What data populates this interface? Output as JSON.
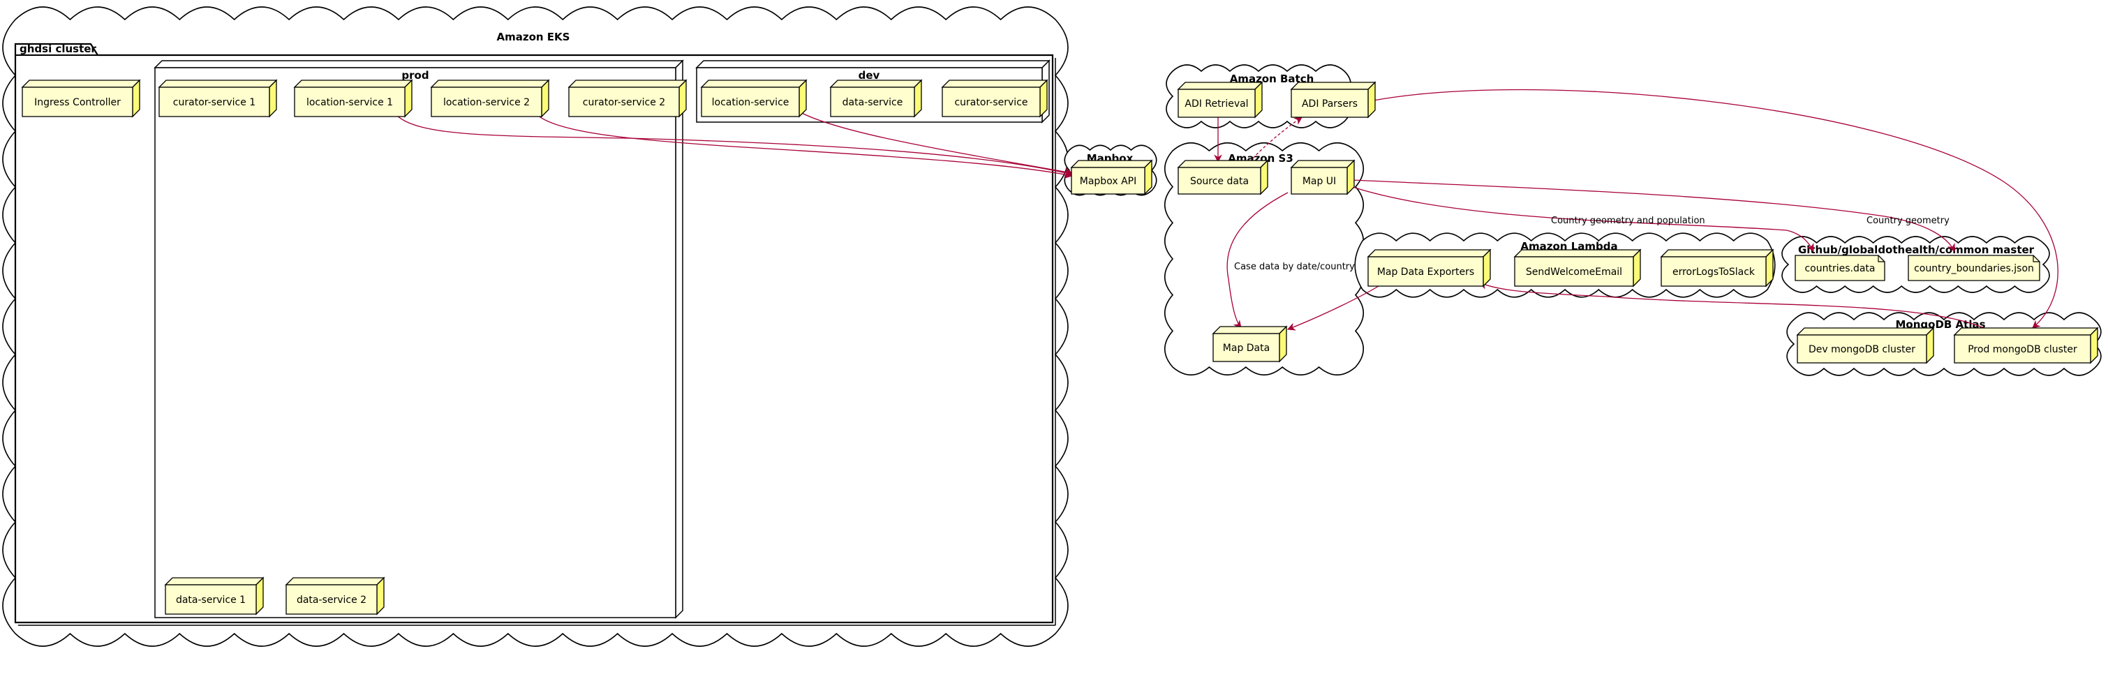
{
  "groups": {
    "eks": "Amazon EKS",
    "cluster": "ghdsi cluster",
    "prod": "prod",
    "dev": "dev",
    "mapbox": "Mapbox",
    "batch": "Amazon Batch",
    "s3": "Amazon S3",
    "lambda": "Amazon Lambda",
    "github": "Github/globaldothealth/common master",
    "mongo": "MongoDB Atlas"
  },
  "nodes": {
    "ingress": "Ingress Controller",
    "prod_curator1": "curator-service 1",
    "prod_location1": "location-service 1",
    "prod_location2": "location-service 2",
    "prod_curator2": "curator-service 2",
    "prod_data1": "data-service 1",
    "prod_data2": "data-service 2",
    "dev_location": "location-service",
    "dev_data": "data-service",
    "dev_curator": "curator-service",
    "mapbox_api": "Mapbox API",
    "adi_retrieval": "ADI Retrieval",
    "adi_parsers": "ADI Parsers",
    "source_data": "Source data",
    "map_ui": "Map UI",
    "map_data": "Map Data",
    "map_exporters": "Map Data Exporters",
    "send_email": "SendWelcomeEmail",
    "error_logs": "errorLogsToSlack",
    "countries_data": "countries.data",
    "country_boundaries": "country_boundaries.json",
    "dev_mongo": "Dev mongoDB cluster",
    "prod_mongo": "Prod mongoDB cluster"
  },
  "edges": {
    "case_data": "Case data by date/country",
    "geo_population": "Country geometry and population",
    "country_geometry": "Country geometry"
  },
  "colors": {
    "node_fill": "#FEFECE",
    "node_side": "#FBFB77",
    "stroke": "#000000",
    "edge": "#A80036"
  }
}
